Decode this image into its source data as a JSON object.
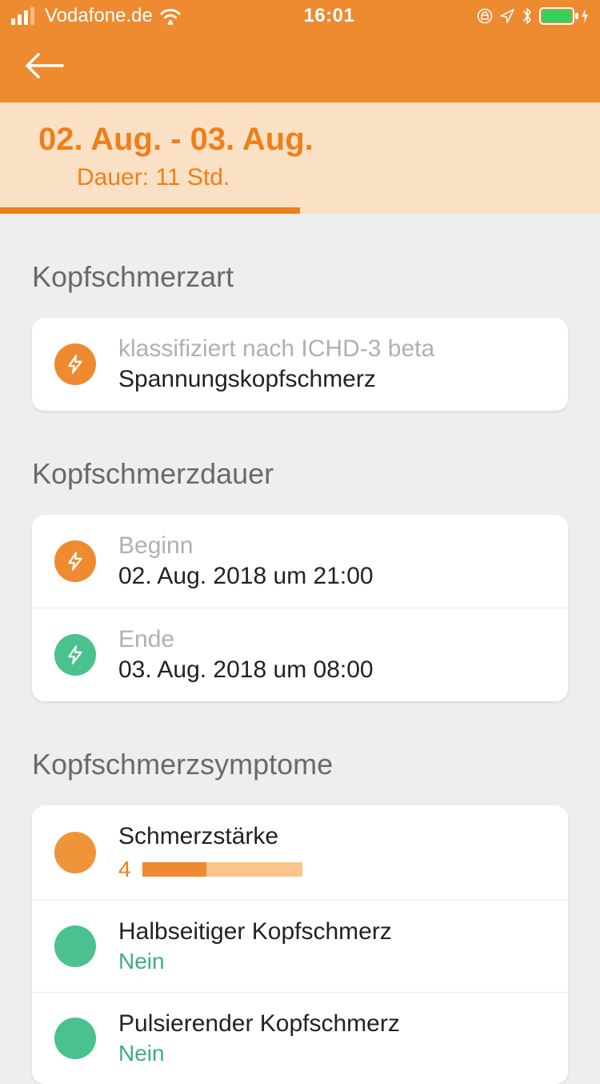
{
  "status": {
    "carrier": "Vodafone.de",
    "time": "16:01"
  },
  "header": {
    "date_range": "02. Aug. - 03. Aug.",
    "duration_label": "Dauer: 11 Std.",
    "progress_percent": 50
  },
  "section_type": {
    "title": "Kopfschmerzart",
    "row": {
      "caption": "klassifiziert nach ICHD-3 beta",
      "value": "Spannungskopfschmerz"
    }
  },
  "section_duration": {
    "title": "Kopfschmerzdauer",
    "begin": {
      "label": "Beginn",
      "value": "02. Aug. 2018 um 21:00"
    },
    "end": {
      "label": "Ende",
      "value": "03. Aug. 2018 um 08:00"
    }
  },
  "section_symptoms": {
    "title": "Kopfschmerzsymptome",
    "intensity": {
      "label": "Schmerzstärke",
      "value": "4",
      "percent": 40
    },
    "one_sided": {
      "label": "Halbseitiger Kopfschmerz",
      "answer": "Nein"
    },
    "pulsing": {
      "label": "Pulsierender Kopfschmerz",
      "answer": "Nein"
    }
  },
  "colors": {
    "accent": "#EE8A30",
    "accent_dark": "#EE7F1A",
    "header_bg": "#FAE1C5",
    "green": "#4AC18F",
    "green_text": "#3CB07E"
  }
}
